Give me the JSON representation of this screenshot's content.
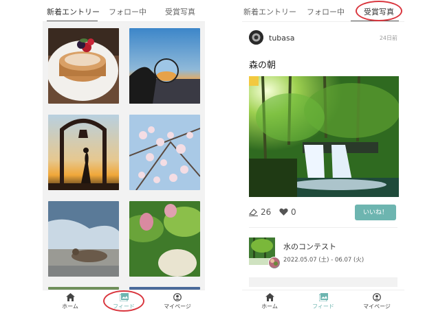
{
  "tabs": [
    "新着エントリー",
    "フォロー中",
    "受賞写真"
  ],
  "bottom_nav": {
    "home": "ホーム",
    "feed": "フィード",
    "mypage": "マイページ"
  },
  "post": {
    "username": "tubasa",
    "time_ago": "24日前",
    "title": "森の朝",
    "views": "26",
    "likes": "0",
    "like_button": "いいね！"
  },
  "contest": {
    "title": "水のコンテスト",
    "date_range": "2022.05.07 (土) - 06.07 (火)"
  },
  "colors": {
    "accent": "#6db5b0",
    "highlight": "#d9363e"
  }
}
